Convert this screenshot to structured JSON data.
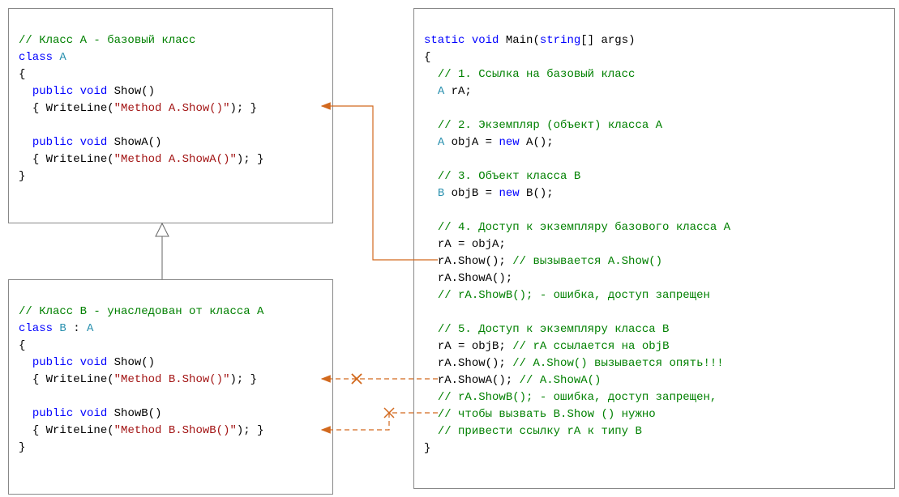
{
  "boxA": {
    "c1": "// Класс A - базовый класс",
    "kw_class": "class",
    "name": "A",
    "obrace": "{",
    "m1_kw_public": "public",
    "m1_kw_void": "void",
    "m1_name": "Show()",
    "m1_body_open": "{ ",
    "m1_call": "WriteLine(",
    "m1_str": "\"Method A.Show()\"",
    "m1_body_close": "); }",
    "m2_kw_public": "public",
    "m2_kw_void": "void",
    "m2_name": "ShowA()",
    "m2_body_open": "{ ",
    "m2_call": "WriteLine(",
    "m2_str": "\"Method A.ShowA()\"",
    "m2_body_close": "); }",
    "cbrace": "}"
  },
  "boxB": {
    "c1": "// Класс B - унаследован от класса A",
    "kw_class": "class",
    "name": "B",
    "colon": " : ",
    "base": "A",
    "obrace": "{",
    "m1_kw_public": "public",
    "m1_kw_void": "void",
    "m1_name": "Show()",
    "m1_body_open": "{ ",
    "m1_call": "WriteLine(",
    "m1_str": "\"Method B.Show()\"",
    "m1_body_close": "); }",
    "m2_kw_public": "public",
    "m2_kw_void": "void",
    "m2_name": "ShowB()",
    "m2_body_open": "{ ",
    "m2_call": "WriteLine(",
    "m2_str": "\"Method B.ShowB()\"",
    "m2_body_close": "); }",
    "cbrace": "}"
  },
  "main": {
    "kw_static": "static",
    "kw_void": "void",
    "name_main": "Main(",
    "kw_string": "string",
    "args": "[] args)",
    "obrace": "{",
    "c1": "// 1. Ссылка на базовый класс",
    "t1_type": "A",
    "t1_var": " rA;",
    "c2": "// 2. Экземпляр (объект) класса A",
    "t2_type": "A",
    "t2_var": " objA = ",
    "t2_new": "new",
    "t2_ctor": " A();",
    "c3": "// 3. Объект класса B",
    "t3_type": "B",
    "t3_var": " objB = ",
    "t3_new": "new",
    "t3_ctor": " B();",
    "c4": "// 4. Доступ к экземпляру базового класса A",
    "l1": "rA = objA;",
    "l2a": "rA.Show(); ",
    "l2b": "// вызывается A.Show()",
    "l3": "rA.ShowA();",
    "c4b": "// rA.ShowB(); - ошибка, доступ запрещен",
    "c5": "// 5. Доступ к экземпляру класса B",
    "l5a": "rA = objB; ",
    "l5b": "// rA ссылается на objB",
    "l6a": "rA.Show(); ",
    "l6b": "// A.Show() вызывается опять!!!",
    "l7a": "rA.ShowA(); ",
    "l7b": "// A.ShowA()",
    "c6a": "// rA.ShowB(); - ошибка, доступ запрещен,",
    "c6b": "// чтобы вызвать B.Show () нужно",
    "c6c": "// привести ссылку rA к типу B",
    "cbrace": "}"
  }
}
